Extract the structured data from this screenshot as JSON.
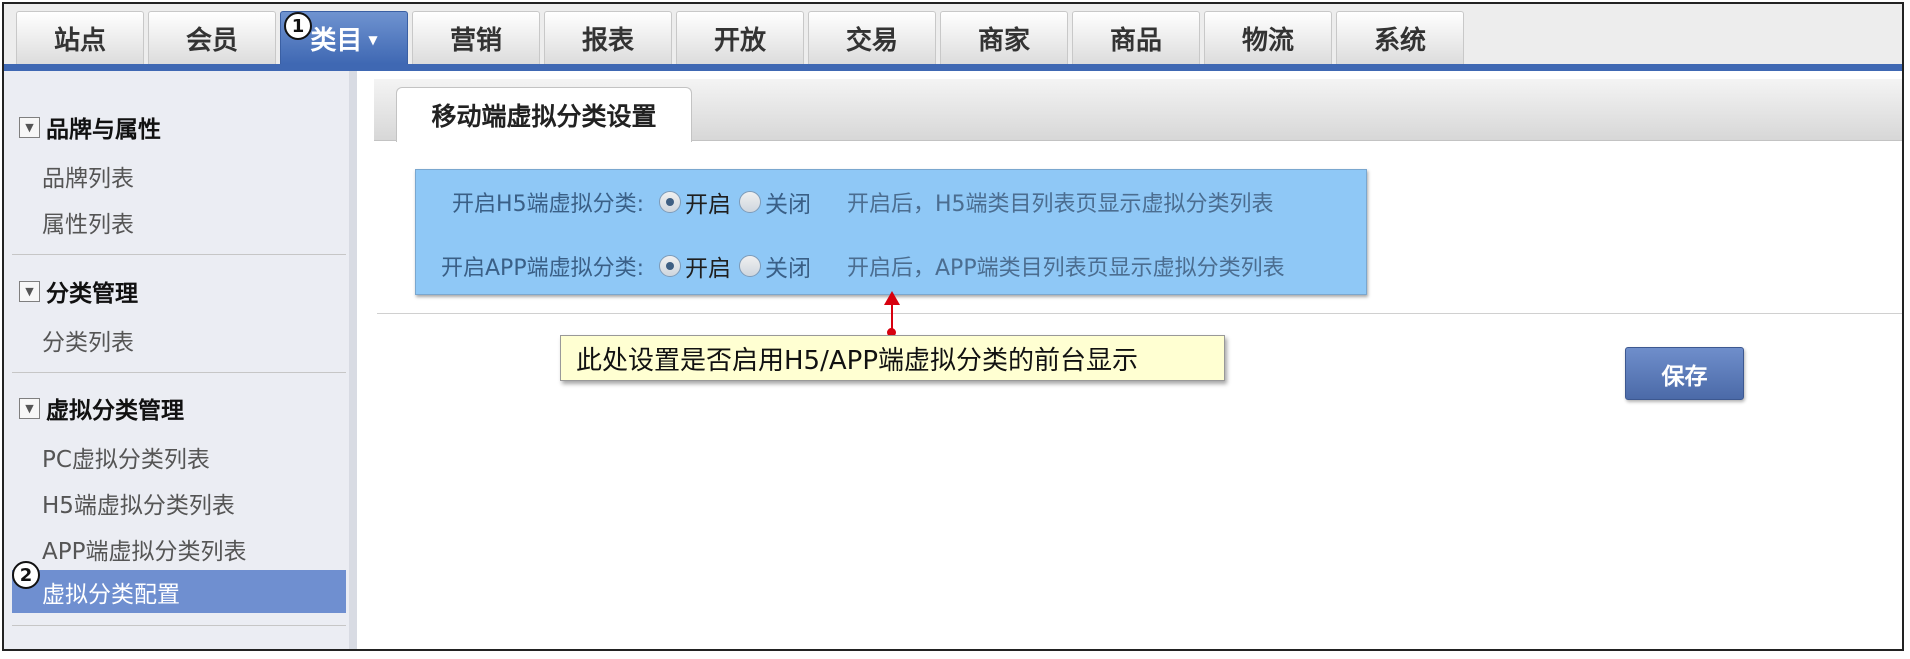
{
  "top_nav": {
    "tabs": [
      "站点",
      "会员",
      "类目",
      "营销",
      "报表",
      "开放",
      "交易",
      "商家",
      "商品",
      "物流",
      "系统"
    ],
    "active_index": 2
  },
  "markers": {
    "one": "1",
    "two": "2"
  },
  "sidebar": {
    "groups": [
      {
        "title": "品牌与属性",
        "items": [
          "品牌列表",
          "属性列表"
        ]
      },
      {
        "title": "分类管理",
        "items": [
          "分类列表"
        ]
      },
      {
        "title": "虚拟分类管理",
        "items": [
          "PC虚拟分类列表",
          "H5端虚拟分类列表",
          "APP端虚拟分类列表",
          "虚拟分类配置"
        ]
      }
    ],
    "active_item": "虚拟分类配置"
  },
  "content": {
    "tab_title": "移动端虚拟分类设置",
    "rows": [
      {
        "label": "开启H5端虚拟分类:",
        "on_label": "开启",
        "off_label": "关闭",
        "selected": "开启",
        "hint": "开启后，H5端类目列表页显示虚拟分类列表"
      },
      {
        "label": "开启APP端虚拟分类:",
        "on_label": "开启",
        "off_label": "关闭",
        "selected": "开启",
        "hint": "开启后，APP端类目列表页显示虚拟分类列表"
      }
    ],
    "callout": "此处设置是否启用H5/APP端虚拟分类的前台显示",
    "save_label": "保存"
  },
  "colors": {
    "accent": "#3f68b3",
    "highlight_box": "#8fc8f6",
    "callout_bg": "#ffffd2",
    "arrow": "#d7000f"
  }
}
